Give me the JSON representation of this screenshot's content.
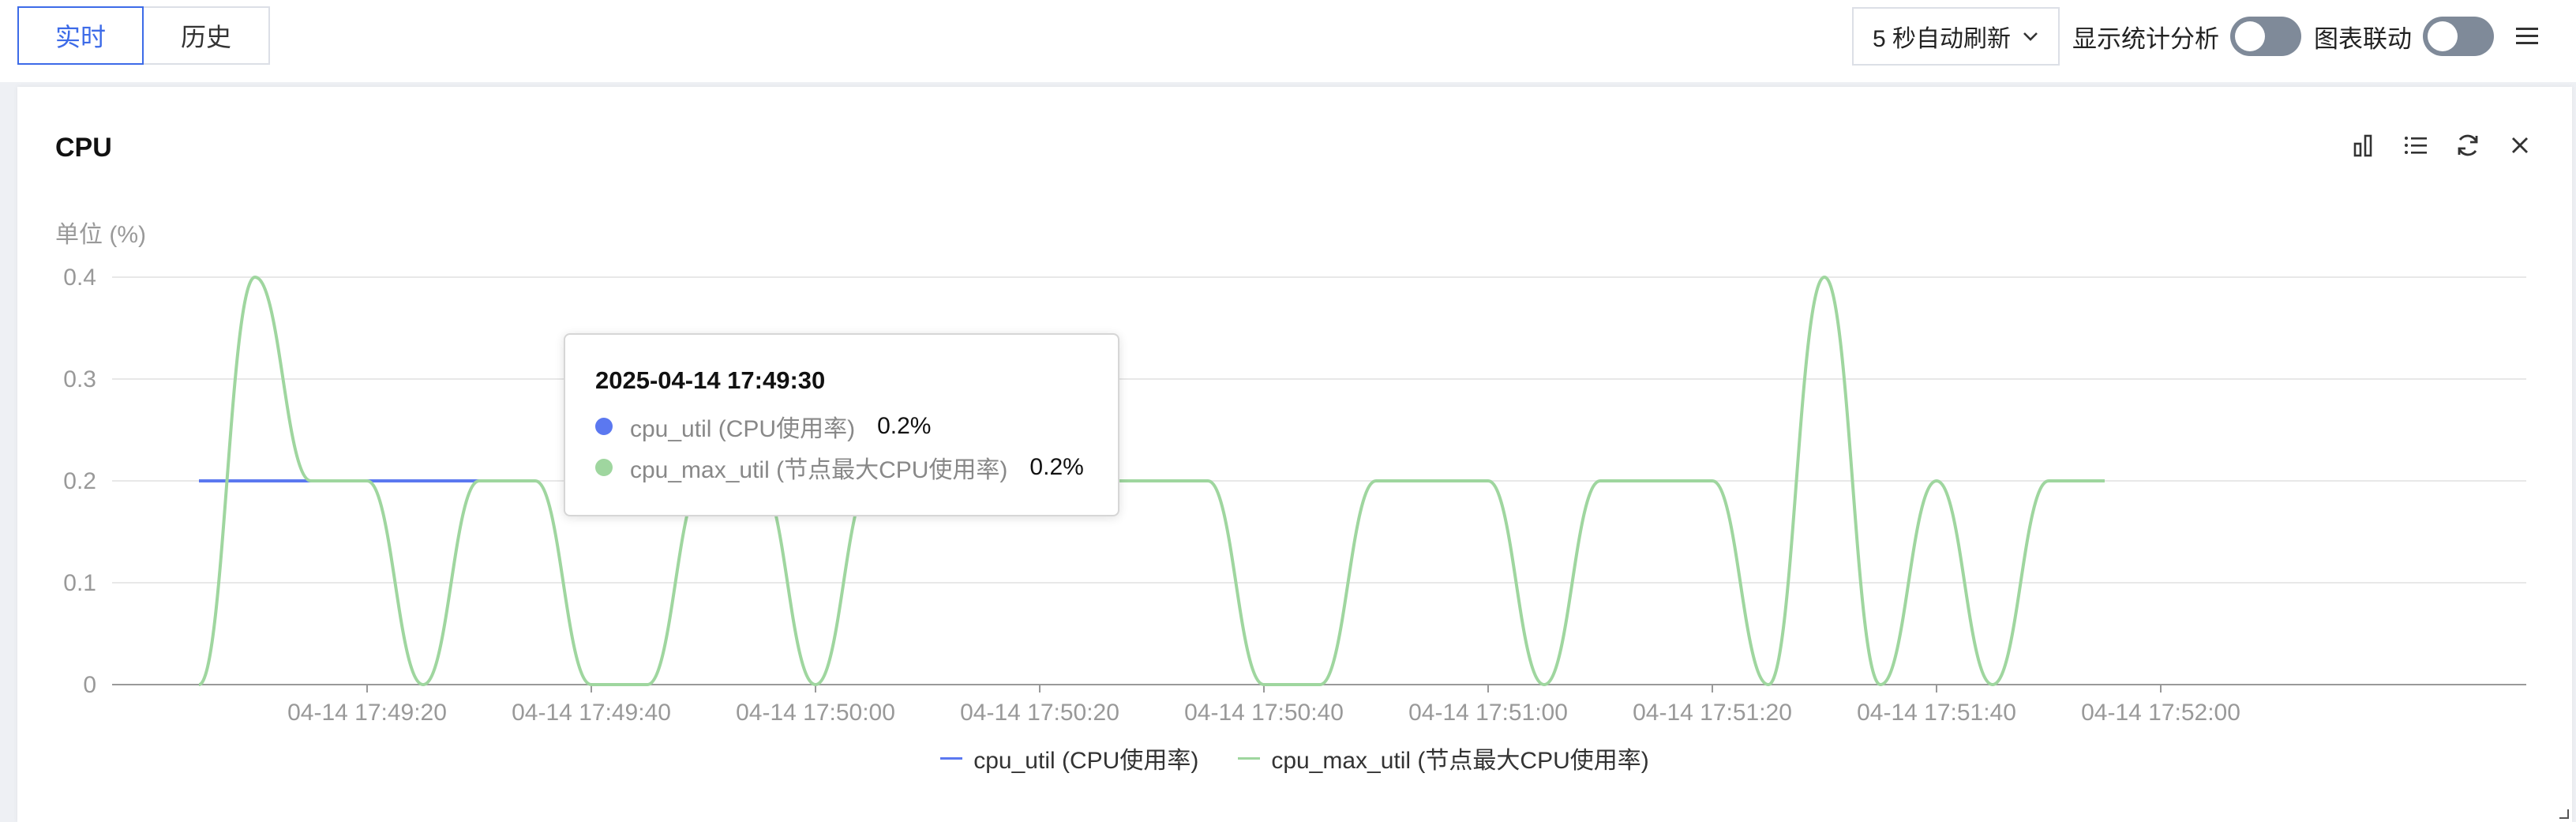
{
  "tabs": [
    "实时",
    "历史"
  ],
  "controls": {
    "refresh_label": "5 秒自动刷新",
    "stats_label": "显示统计分析",
    "link_label": "图表联动"
  },
  "card": {
    "title": "CPU",
    "unit": "单位 (%)"
  },
  "tooltip": {
    "date": "2025-04-14 17:49:30",
    "rows": [
      {
        "name": "cpu_util (CPU使用率)",
        "value": "0.2%",
        "color": "#5b78f0"
      },
      {
        "name": "cpu_max_util (节点最大CPU使用率)",
        "value": "0.2%",
        "color": "#9fd69f"
      }
    ]
  },
  "chart_data": {
    "type": "line",
    "x_labels": [
      "04-14 17:49:20",
      "04-14 17:49:40",
      "04-14 17:50:00",
      "04-14 17:50:20",
      "04-14 17:50:40",
      "04-14 17:51:00",
      "04-14 17:51:20",
      "04-14 17:51:40",
      "04-14 17:52:00"
    ],
    "y_ticks": [
      0,
      0.1,
      0.2,
      0.3,
      0.4
    ],
    "ylim": [
      0,
      0.4
    ],
    "grid": true,
    "legend_position": "bottom",
    "series": [
      {
        "name": "cpu_util (CPU使用率)",
        "color": "#5b78f0",
        "points": [
          [
            "17:49:05",
            0.2
          ],
          [
            "17:49:30",
            0.2
          ]
        ]
      },
      {
        "name": "cpu_max_util (节点最大CPU使用率)",
        "color": "#9fd69f",
        "points": [
          [
            "17:49:05",
            0
          ],
          [
            "17:49:10",
            0.4
          ],
          [
            "17:49:15",
            0.2
          ],
          [
            "17:49:20",
            0.2
          ],
          [
            "17:49:25",
            0
          ],
          [
            "17:49:30",
            0.2
          ],
          [
            "17:49:35",
            0.2
          ],
          [
            "17:49:40",
            0
          ],
          [
            "17:49:45",
            0
          ],
          [
            "17:49:50",
            0.2
          ],
          [
            "17:49:55",
            0.2
          ],
          [
            "17:50:00",
            0
          ],
          [
            "17:50:05",
            0.2
          ],
          [
            "17:50:10",
            0.2
          ],
          [
            "17:50:15",
            0.2
          ],
          [
            "17:50:20",
            0.2
          ],
          [
            "17:50:25",
            0.2
          ],
          [
            "17:50:30",
            0.2
          ],
          [
            "17:50:35",
            0.2
          ],
          [
            "17:50:40",
            0
          ],
          [
            "17:50:45",
            0
          ],
          [
            "17:50:50",
            0.2
          ],
          [
            "17:50:55",
            0.2
          ],
          [
            "17:51:00",
            0.2
          ],
          [
            "17:51:05",
            0
          ],
          [
            "17:51:10",
            0.2
          ],
          [
            "17:51:15",
            0.2
          ],
          [
            "17:51:20",
            0.2
          ],
          [
            "17:51:25",
            0
          ],
          [
            "17:51:30",
            0.4
          ],
          [
            "17:51:35",
            0
          ],
          [
            "17:51:40",
            0.2
          ],
          [
            "17:51:45",
            0
          ],
          [
            "17:51:50",
            0.2
          ],
          [
            "17:51:55",
            0.2
          ]
        ]
      }
    ]
  }
}
